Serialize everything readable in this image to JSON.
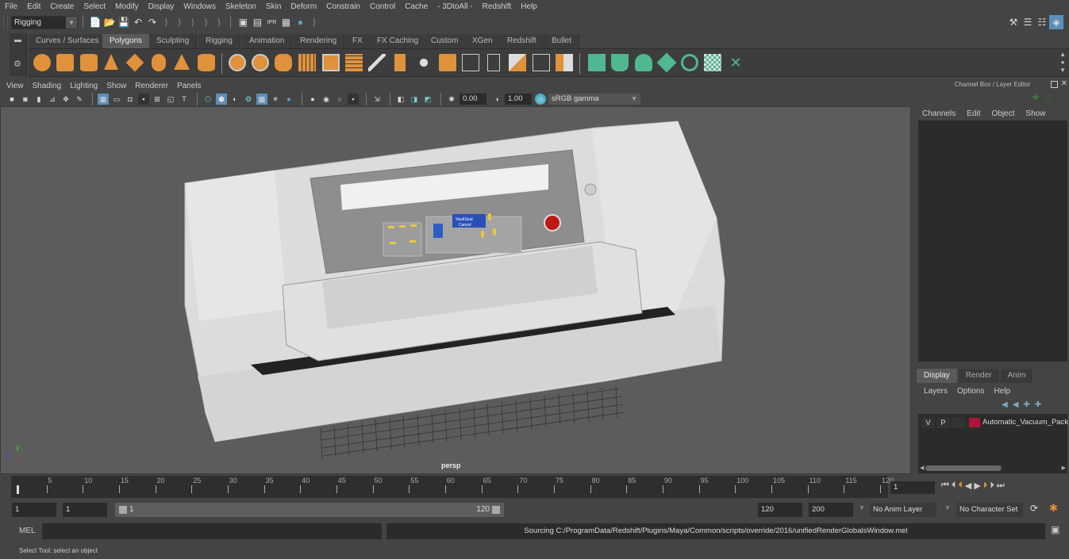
{
  "menubar": {
    "items": [
      "File",
      "Edit",
      "Create",
      "Select",
      "Modify",
      "Display",
      "Windows",
      "Skeleton",
      "Skin",
      "Deform",
      "Constrain",
      "Control",
      "Cache",
      "- 3DtoAll -",
      "Redshift",
      "Help"
    ]
  },
  "statusline": {
    "mode": "Rigging",
    "icons": [
      "new-scene-icon",
      "open-scene-icon",
      "save-scene-icon",
      "undo-icon",
      "redo-icon"
    ],
    "render_icons": [
      "render-frame-icon",
      "render-sequence-icon",
      "ipr-render-icon",
      "render-settings-icon",
      "hypershade-icon"
    ]
  },
  "shelf": {
    "tabs": [
      "Curves / Surfaces",
      "Polygons",
      "Sculpting",
      "Rigging",
      "Animation",
      "Rendering",
      "FX",
      "FX Caching",
      "Custom",
      "XGen",
      "Redshift",
      "Bullet"
    ],
    "active_tab": "Polygons",
    "poly_icons": [
      "poly-sphere-icon",
      "poly-cube-icon",
      "poly-cylinder-icon",
      "poly-cone-icon",
      "poly-plane-icon",
      "poly-torus-icon",
      "poly-pyramid-icon",
      "poly-pipe-icon"
    ],
    "edit_icons": [
      "combine-icon",
      "separate-icon",
      "mirror-icon",
      "smooth-icon",
      "extrude-icon",
      "bridge-icon",
      "multi-cut-icon",
      "bevel-icon",
      "merge-icon",
      "bool-icon",
      "fill-hole-icon",
      "insert-edge-loop-icon",
      "target-weld-icon",
      "quad-draw-icon",
      "append-poly-icon"
    ],
    "uv_icons": [
      "planar-uv-icon",
      "cylindrical-uv-icon",
      "spherical-uv-icon",
      "automatic-uv-icon",
      "unfold-uv-icon",
      "uv-editor-icon",
      "cut-uv-icon"
    ]
  },
  "viewport": {
    "menu": [
      "View",
      "Shading",
      "Lighting",
      "Show",
      "Renderer",
      "Panels"
    ],
    "exposure": "0.00",
    "gamma": "1.00",
    "color_space": "sRGB gamma",
    "camera_label": "persp",
    "model": {
      "panel_button": "Vac&Seal",
      "panel_button_sub": "Cancel"
    }
  },
  "channelbox": {
    "title": "Channel Box / Layer Editor",
    "menu": [
      "Channels",
      "Edit",
      "Object",
      "Show"
    ]
  },
  "layer_editor": {
    "tabs": [
      "Display",
      "Render",
      "Anim"
    ],
    "active_tab": "Display",
    "menu": [
      "Layers",
      "Options",
      "Help"
    ],
    "layers": [
      {
        "v": "V",
        "p": "P",
        "color": "#b0143a",
        "name": "Automatic_Vacuum_Pack"
      }
    ]
  },
  "timeline": {
    "ticks": [
      "5",
      "10",
      "15",
      "20",
      "25",
      "30",
      "35",
      "40",
      "45",
      "50",
      "55",
      "60",
      "65",
      "70",
      "75",
      "80",
      "85",
      "90",
      "95",
      "100",
      "105",
      "110",
      "115",
      "120"
    ],
    "current_frame": "1",
    "playback": [
      "go-to-start-icon",
      "step-back-key-icon",
      "step-back-frame-icon",
      "play-backward-icon",
      "play-forward-icon",
      "step-forward-frame-icon",
      "step-forward-key-icon",
      "go-to-end-icon"
    ]
  },
  "range": {
    "start": "1",
    "playback_start": "1",
    "slider_start": "1",
    "slider_end": "120",
    "playback_end": "120",
    "end": "200",
    "anim_layer": "No Anim Layer",
    "character_set": "No Character Set"
  },
  "commandline": {
    "label": "MEL",
    "result": "Sourcing C:/ProgramData/Redshift/Plugins/Maya/Common/scripts/override/2016/unifiedRenderGlobalsWindow.mel"
  },
  "helpline": {
    "text": "Select Tool: select an object"
  }
}
